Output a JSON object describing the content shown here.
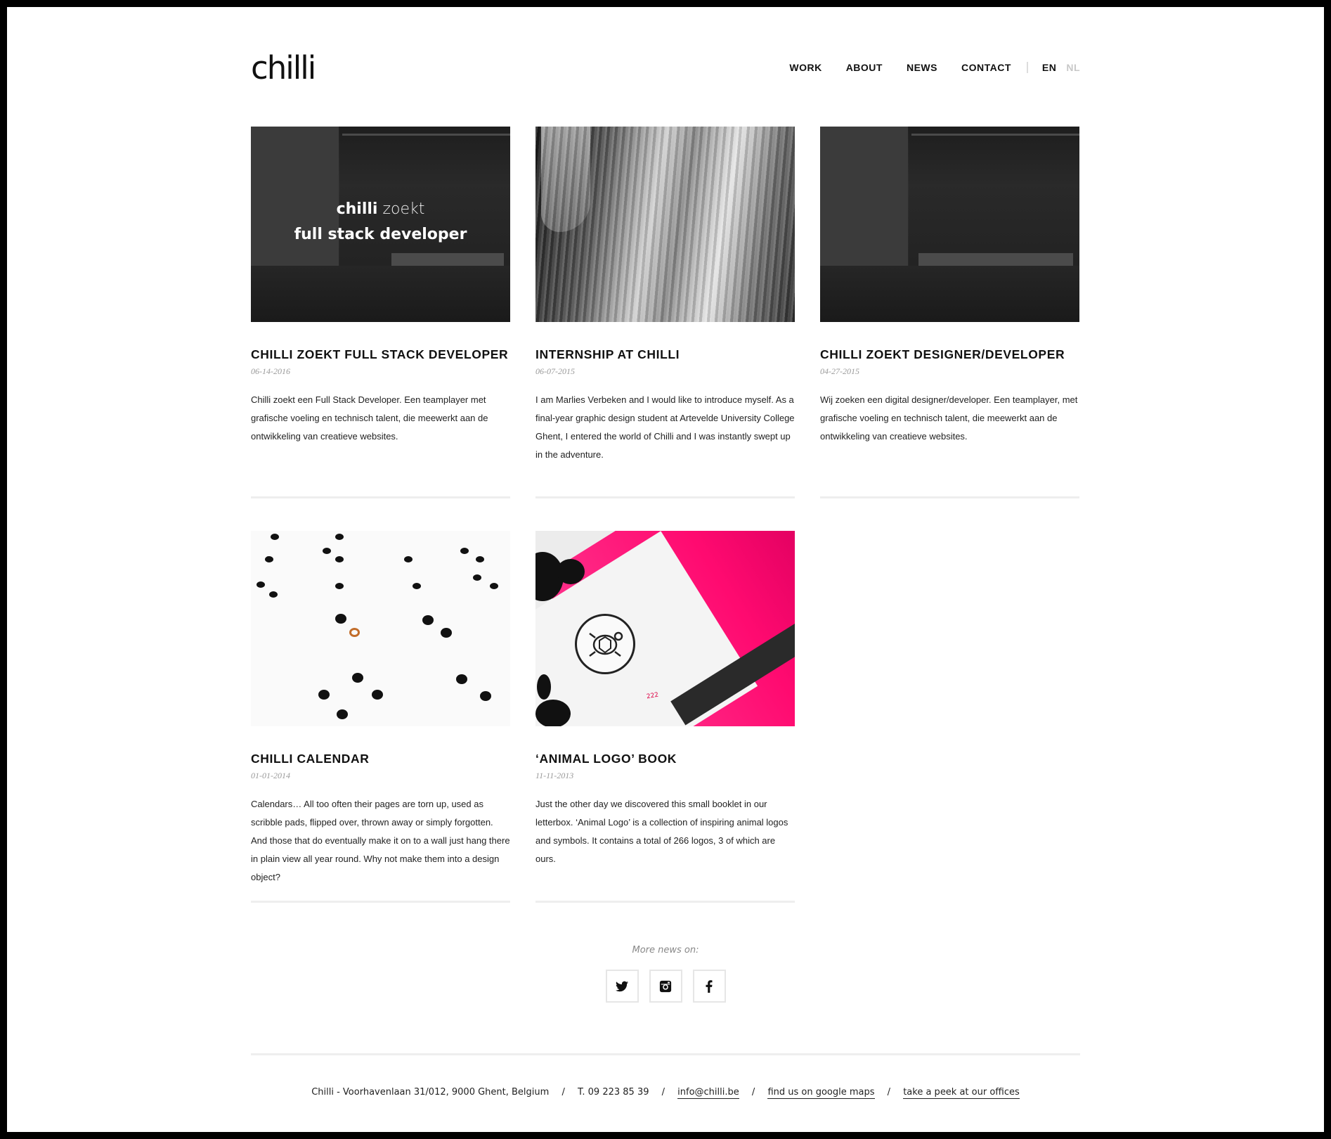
{
  "logo": "chilli",
  "nav": {
    "items": [
      "WORK",
      "ABOUT",
      "NEWS",
      "CONTACT"
    ],
    "lang_active": "EN",
    "lang_inactive": "NL"
  },
  "posts": [
    {
      "title": "CHILLI ZOEKT FULL STACK DEVELOPER",
      "date": "06-14-2016",
      "excerpt": "Chilli zoekt een Full Stack Developer. Een teamplayer met grafische voeling en technisch talent, die meewerkt aan de ontwikkeling van creatieve websites.",
      "image_overlay": {
        "brand": "chilli",
        "word": "zoekt",
        "role": "full stack developer"
      }
    },
    {
      "title": "INTERNSHIP AT CHILLI",
      "date": "06-07-2015",
      "excerpt": "I am Marlies Verbeken and I would like to introduce myself. As a final-year graphic design student at Artevelde University College Ghent, I entered the world of Chilli and I was instantly swept up in the adventure."
    },
    {
      "title": "CHILLI ZOEKT DESIGNER/DEVELOPER",
      "date": "04-27-2015",
      "excerpt": "Wij zoeken een digital designer/developer. Een teamplayer, met grafische voeling en technisch talent, die meewerkt aan de ontwikkeling van creatieve websites."
    },
    {
      "title": "CHILLI CALENDAR",
      "date": "01-01-2014",
      "excerpt": "Calendars… All too often their pages are torn up, used as scribble pads, flipped over, thrown away or simply forgotten. And those that do eventually make it on to a wall just hang there in plain view all year round. Why not make them into a design object?"
    },
    {
      "title": "‘ANIMAL LOGO’ BOOK",
      "date": "11-11-2013",
      "excerpt": "Just the other day we discovered this small booklet in our letterbox. ‘Animal Logo’ is a collection of inspiring animal logos and symbols. It contains a total of 266 logos, 3 of which are ours."
    }
  ],
  "social": {
    "label": "More news on:",
    "icons": [
      "twitter-icon",
      "instagram-icon",
      "facebook-icon"
    ]
  },
  "footer": {
    "address": "Chilli - Voorhavenlaan 31/012, 9000 Ghent, Belgium",
    "phone": "T. 09 223 85 39",
    "email": "info@chilli.be",
    "maps": "find us on google maps",
    "offices": "take a peek at our offices",
    "separator": "/"
  },
  "colors": {
    "background": "#ffffff",
    "frame": "#000000",
    "text": "#111111",
    "muted": "#9a9a9a",
    "rule": "#eeeeee",
    "lang_inactive": "#c8c8c8"
  }
}
